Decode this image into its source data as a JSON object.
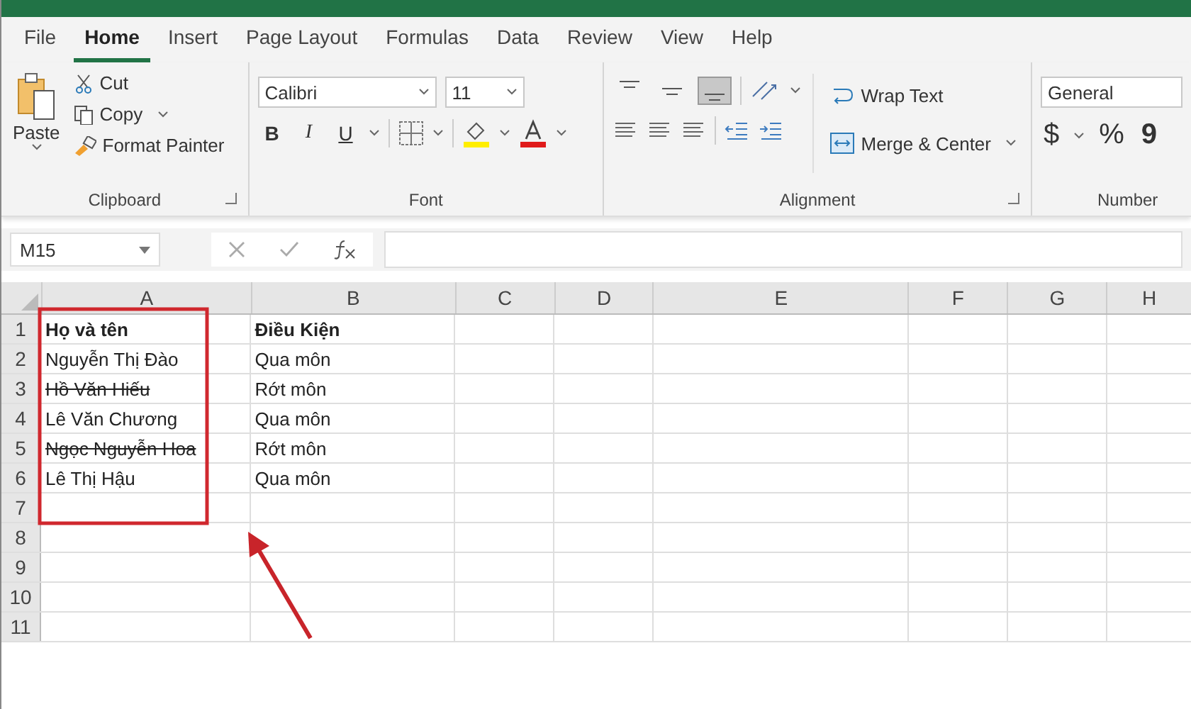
{
  "tabs": [
    {
      "label": "File",
      "selected": false
    },
    {
      "label": "Home",
      "selected": true
    },
    {
      "label": "Insert",
      "selected": false
    },
    {
      "label": "Page Layout",
      "selected": false
    },
    {
      "label": "Formulas",
      "selected": false
    },
    {
      "label": "Data",
      "selected": false
    },
    {
      "label": "Review",
      "selected": false
    },
    {
      "label": "View",
      "selected": false
    },
    {
      "label": "Help",
      "selected": false
    }
  ],
  "clipboard": {
    "paste": "Paste",
    "cut": "Cut",
    "copy": "Copy",
    "format_painter": "Format Painter",
    "label": "Clipboard"
  },
  "font": {
    "name": "Calibri",
    "size": "11",
    "bold": "B",
    "italic": "I",
    "underline": "U",
    "label": "Font"
  },
  "alignment": {
    "vertical_align": [
      {
        "kind": "top",
        "selected": false
      },
      {
        "kind": "middle",
        "selected": false
      },
      {
        "kind": "bottom",
        "selected": true
      }
    ],
    "wrap_text": "Wrap Text",
    "merge_center": "Merge & Center",
    "label": "Alignment"
  },
  "number": {
    "format": "General",
    "currency": "$",
    "percent": "%",
    "comma": "9",
    "label": "Number"
  },
  "name_box": "M15",
  "columns": [
    "A",
    "B",
    "C",
    "D",
    "E",
    "F",
    "G",
    "H"
  ],
  "rows": [
    {
      "number": "1",
      "cells": [
        {
          "text": "Họ và tên",
          "bold": true,
          "strikethrough": false
        },
        {
          "text": "Điều Kiện",
          "bold": true,
          "strikethrough": false
        }
      ]
    },
    {
      "number": "2",
      "cells": [
        {
          "text": "Nguyễn Thị Đào",
          "bold": false,
          "strikethrough": false
        },
        {
          "text": "Qua môn",
          "bold": false,
          "strikethrough": false
        }
      ]
    },
    {
      "number": "3",
      "cells": [
        {
          "text": "Hồ Văn Hiếu",
          "bold": false,
          "strikethrough": true
        },
        {
          "text": "Rớt môn",
          "bold": false,
          "strikethrough": false
        }
      ]
    },
    {
      "number": "4",
      "cells": [
        {
          "text": "Lê Văn Chương",
          "bold": false,
          "strikethrough": false
        },
        {
          "text": "Qua môn",
          "bold": false,
          "strikethrough": false
        }
      ]
    },
    {
      "number": "5",
      "cells": [
        {
          "text": "Ngọc Nguyễn Hoa",
          "bold": false,
          "strikethrough": true
        },
        {
          "text": "Rớt môn",
          "bold": false,
          "strikethrough": false
        }
      ]
    },
    {
      "number": "6",
      "cells": [
        {
          "text": "Lê Thị Hậu",
          "bold": false,
          "strikethrough": false
        },
        {
          "text": "Qua môn",
          "bold": false,
          "strikethrough": false
        }
      ]
    },
    {
      "number": "7",
      "cells": []
    },
    {
      "number": "8",
      "cells": []
    },
    {
      "number": "9",
      "cells": []
    },
    {
      "number": "10",
      "cells": []
    },
    {
      "number": "11",
      "cells": []
    }
  ]
}
